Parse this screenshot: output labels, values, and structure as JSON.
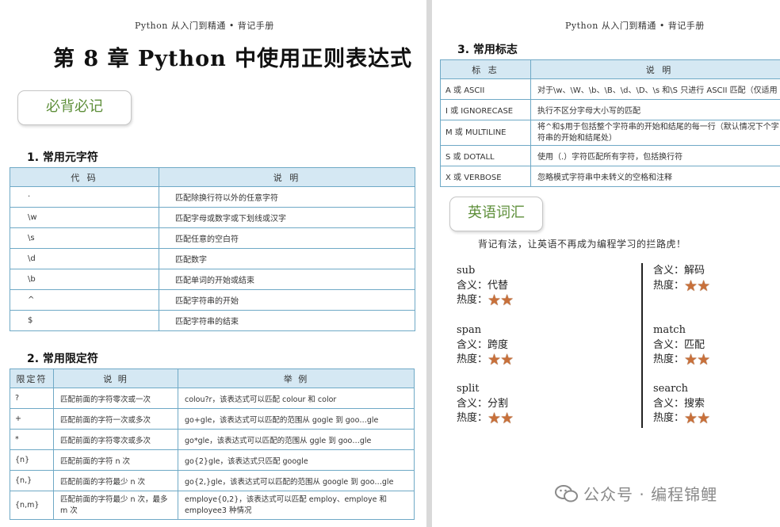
{
  "left_page": {
    "running_header": "Python 从入门到精通 • 背记手册",
    "chapter_title": "第 8 章  Python 中使用正则表达式",
    "callout": "必背必记",
    "section1": {
      "heading": "1. 常用元字符",
      "columns": [
        "代 码",
        "说 明"
      ],
      "rows": [
        [
          "·",
          "匹配除换行符以外的任意字符"
        ],
        [
          "\\w",
          "匹配字母或数字或下划线或汉字"
        ],
        [
          "\\s",
          "匹配任意的空白符"
        ],
        [
          "\\d",
          "匹配数字"
        ],
        [
          "\\b",
          "匹配单词的开始或结束"
        ],
        [
          "^",
          "匹配字符串的开始"
        ],
        [
          "$",
          "匹配字符串的结束"
        ]
      ]
    },
    "section2": {
      "heading": "2. 常用限定符",
      "columns": [
        "限定符",
        "说 明",
        "举 例"
      ],
      "rows": [
        [
          "?",
          "匹配前面的字符零次或一次",
          "colou?r，该表达式可以匹配 colour 和 color"
        ],
        [
          "+",
          "匹配前面的字符一次或多次",
          "go+gle，该表达式可以匹配的范围从 gogle 到 goo…gle"
        ],
        [
          "*",
          "匹配前面的字符零次或多次",
          "go*gle，该表达式可以匹配的范围从 ggle 到 goo…gle"
        ],
        [
          "{n}",
          "匹配前面的字符 n 次",
          "go{2}gle，该表达式只匹配 google"
        ],
        [
          "{n,}",
          "匹配前面的字符最少 n 次",
          "go{2,}gle，该表达式可以匹配的范围从 google 到 goo…gle"
        ],
        [
          "{n,m}",
          "匹配前面的字符最少 n 次，最多 m 次",
          "employe{0,2}，该表达式可以匹配 employ、employe 和 employee3 种情况"
        ]
      ]
    }
  },
  "right_page": {
    "running_header": "Python 从入门到精通 • 背记手册",
    "section3": {
      "heading": "3. 常用标志",
      "columns": [
        "标 志",
        "说 明"
      ],
      "rows": [
        [
          "A 或 ASCII",
          "对于\\w、\\W、\\b、\\B、\\d、\\D、\\s  和\\S 只进行 ASCII 匹配（仅适用"
        ],
        [
          "I 或 IGNORECASE",
          "执行不区分字母大小写的匹配"
        ],
        [
          "M 或 MULTILINE",
          "将^和$用于包括整个字符串的开始和结尾的每一行（默认情况下个字符串的开始和结尾处）"
        ],
        [
          "S 或 DOTALL",
          "使用（.）字符匹配所有字符，包括换行符"
        ],
        [
          "X 或 VERBOSE",
          "忽略模式字符串中未转义的空格和注释"
        ]
      ]
    },
    "callout": "英语词汇",
    "vocab_intro": "背记有法，让英语不再成为编程学习的拦路虎！",
    "meaning_label": "含义：",
    "heat_label": "热度：",
    "vocab_left": [
      {
        "word": "sub",
        "meaning": "代替",
        "stars": 2
      },
      {
        "word": "span",
        "meaning": "跨度",
        "stars": 2
      },
      {
        "word": "split",
        "meaning": "分割",
        "stars": 2
      }
    ],
    "vocab_right": [
      {
        "word": "",
        "meaning": "解码",
        "stars": 2
      },
      {
        "word": "match",
        "meaning": "匹配",
        "stars": 2
      },
      {
        "word": "search",
        "meaning": "搜索",
        "stars": 2
      }
    ],
    "watermark": "公众号 · 编程锦鲤",
    "colors": {
      "table_header_bg": "#d5e8f3",
      "table_border": "#6fa9c6",
      "callout_text": "#5e8f3a",
      "star": "#c8703a"
    }
  }
}
